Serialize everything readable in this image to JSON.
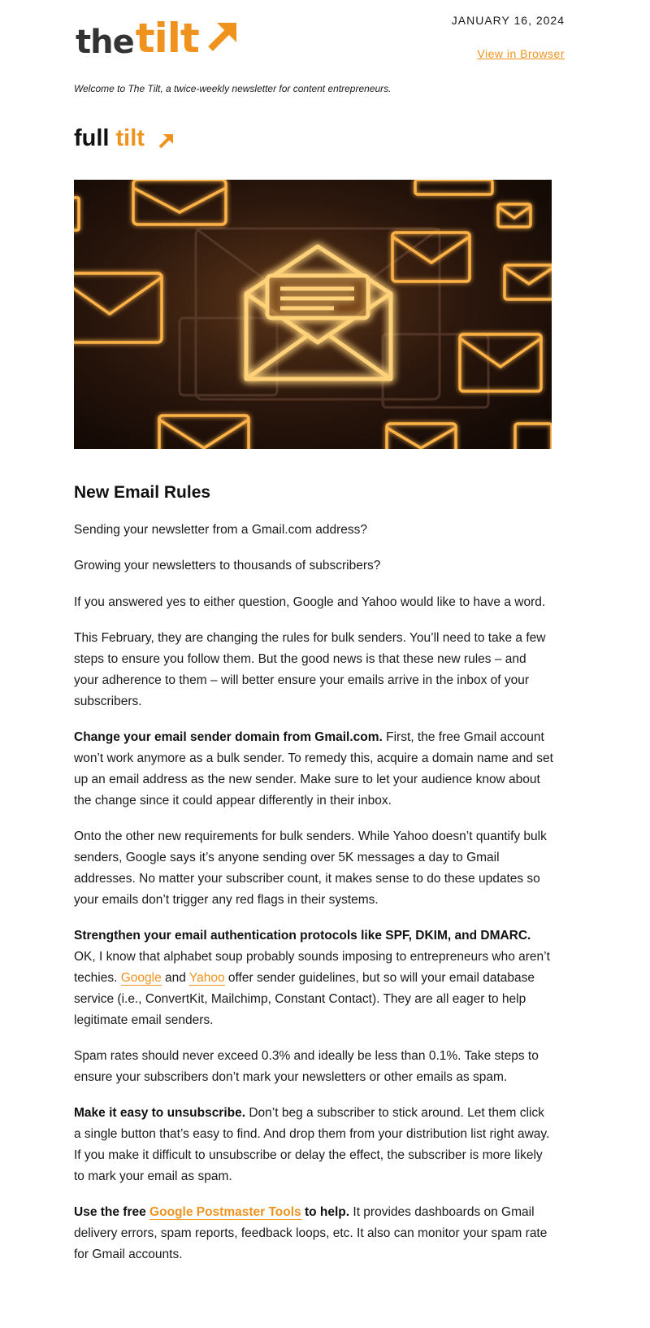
{
  "header": {
    "logo_word_the": "the",
    "logo_word_tilt": "tilt",
    "date": "JANUARY 16, 2024",
    "view_in_browser": "View in Browser",
    "welcome": "Welcome to The Tilt, a twice-weekly newsletter for content entrepreneurs."
  },
  "section": {
    "word_full": "full",
    "word_tilt": "tilt"
  },
  "hero_image": {
    "icon": "glowing-envelopes-illustration"
  },
  "article": {
    "title": "New Email Rules",
    "p1": "Sending your newsletter from a Gmail.com address?",
    "p2": "Growing your newsletters to thousands of subscribers?",
    "p3": "If you answered yes to either question, Google and Yahoo would like to have a word.",
    "p4": "This February, they are changing the rules for bulk senders. You’ll need to take a few steps to ensure you follow them. But the good news is that these new rules – and your adherence to them – will better ensure your emails arrive in the inbox of your subscribers.",
    "p5_bold": "Change your email sender domain from Gmail.com.",
    "p5_text": " First, the free Gmail account won’t work anymore as a bulk sender. To remedy this, acquire a domain name and set up an email address as the new sender. Make sure to let your audience know about the change since it could appear differently in their inbox.",
    "p6": "Onto the other new requirements for bulk senders. While Yahoo doesn’t quantify bulk senders, Google says it’s anyone sending over 5K messages a day to Gmail addresses. No matter your subscriber count, it makes sense to do these updates so your emails don’t trigger any red flags in their systems.",
    "p7_bold": "Strengthen your email authentication protocols like SPF, DKIM, and DMARC.",
    "p7_text_a": " OK, I know that alphabet soup probably sounds imposing to entrepreneurs who aren’t techies. ",
    "p7_link_google": "Google",
    "p7_text_b": " and ",
    "p7_link_yahoo": "Yahoo",
    "p7_text_c": " offer sender guidelines, but so will your email database service (i.e., ConvertKit, Mailchimp, Constant Contact). They are all eager to help legitimate email senders.",
    "p8": "Spam rates should never exceed 0.3% and ideally be less than 0.1%. Take steps to ensure your subscribers don’t mark your newsletters or other emails as spam.",
    "p9_bold": "Make it easy to unsubscribe.",
    "p9_text": " Don’t beg a subscriber to stick around. Let them click a single button that’s easy to find. And drop them from your distribution list right away. If you make it difficult to unsubscribe or delay the effect, the subscriber is more likely to mark your email as spam.",
    "p10_bold_a": "Use the free ",
    "p10_link": "Google Postmaster Tools",
    "p10_bold_b": " to help.",
    "p10_text": " It provides dashboards on Gmail delivery errors, spam reports, feedback loops, etc. It also can monitor your spam rate for Gmail accounts."
  },
  "colors": {
    "accent": "#f0931e",
    "logo_dark": "#333333",
    "text": "#1a1a1a"
  }
}
